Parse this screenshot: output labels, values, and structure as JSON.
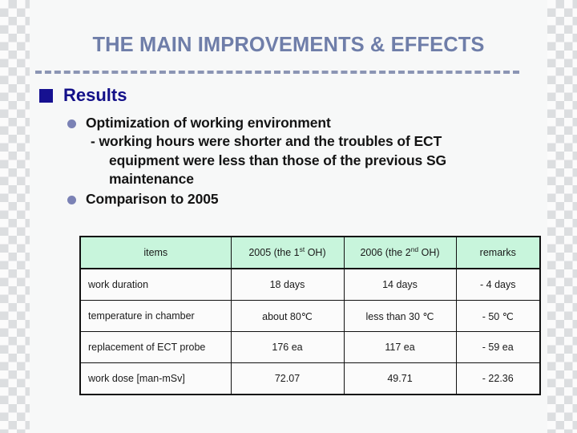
{
  "slide": {
    "title": "THE MAIN IMPROVEMENTS & EFFECTS",
    "section_heading": "Results"
  },
  "bullets": [
    {
      "text": "Optimization of working environment",
      "sub": [
        "-  working hours were shorter and the  troubles of ECT",
        "equipment were less than those of the previous SG",
        "maintenance"
      ]
    },
    {
      "text": "Comparison to 2005",
      "sub": []
    }
  ],
  "table": {
    "headers": {
      "items": "items",
      "col2_prefix": "2005 (the 1",
      "col2_sup": "st",
      "col2_suffix": " OH)",
      "col3_prefix": "2006 (the 2",
      "col3_sup": "nd",
      "col3_suffix": " OH)",
      "remarks": "remarks"
    },
    "rows": [
      {
        "item": "work duration",
        "v2005": "18 days",
        "v2006": "14 days",
        "remark": "- 4 days",
        "tall": false
      },
      {
        "item": "temperature in chamber",
        "v2005": "about 80℃",
        "v2006": "less than 30 ℃",
        "remark": "- 50 ℃",
        "tall": false
      },
      {
        "item": "replacement of ECT probe",
        "v2005": "176 ea",
        "v2006": "117 ea",
        "remark": "- 59 ea",
        "tall": true
      },
      {
        "item": "work dose [man-mSv]",
        "v2005": "72.07",
        "v2006": "49.71",
        "remark": "- 22.36",
        "tall": false
      }
    ]
  },
  "colors": {
    "title": "#6f7ea9",
    "heading": "#131089",
    "bullet_dot": "#7b82b5",
    "header_bg": "#c8f5dc",
    "remark_text": "#bf1d22",
    "background": "#f7f8f8"
  }
}
